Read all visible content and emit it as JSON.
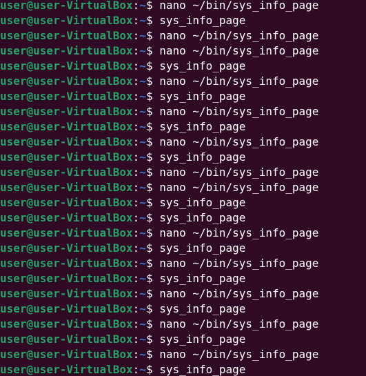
{
  "terminal": {
    "prompt": {
      "user_host": "user@user-VirtualBox",
      "separator": ":",
      "path": "~",
      "symbol": "$ "
    },
    "colors": {
      "background": "#300a24",
      "user_host": "#26a269",
      "path": "#3b78c9",
      "text": "#ffffff"
    },
    "commands": [
      "nano ~/bin/sys_info_page",
      "sys_info_page",
      "nano ~/bin/sys_info_page",
      "nano ~/bin/sys_info_page",
      "sys_info_page",
      "nano ~/bin/sys_info_page",
      "sys_info_page",
      "nano ~/bin/sys_info_page",
      "sys_info_page",
      "nano ~/bin/sys_info_page",
      "sys_info_page",
      "nano ~/bin/sys_info_page",
      "nano ~/bin/sys_info_page",
      "sys_info_page",
      "sys_info_page",
      "nano ~/bin/sys_info_page",
      "sys_info_page",
      "nano ~/bin/sys_info_page",
      "sys_info_page",
      "nano ~/bin/sys_info_page",
      "sys_info_page",
      "nano ~/bin/sys_info_page",
      "sys_info_page",
      "nano ~/bin/sys_info_page",
      "sys_info_page"
    ]
  }
}
